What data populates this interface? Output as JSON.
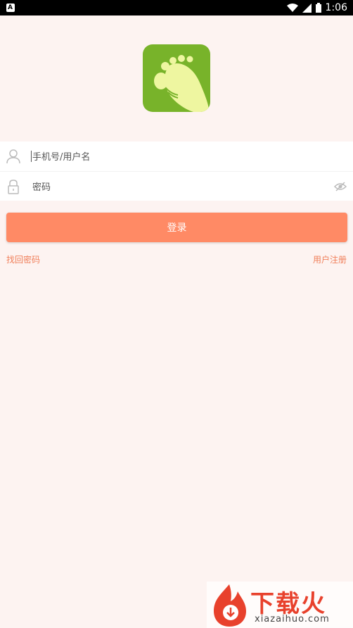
{
  "status_bar": {
    "time": "1:06",
    "notification_icon": "A"
  },
  "logo": {
    "name": "footprint-logo",
    "bg_color": "#78b32a",
    "foot_color": "#eef6a0"
  },
  "login_form": {
    "username": {
      "placeholder": "手机号/用户名",
      "value": ""
    },
    "password": {
      "placeholder": "密码",
      "value": ""
    },
    "login_label": "登录",
    "forgot_label": "找回密码",
    "register_label": "用户注册"
  },
  "colors": {
    "accent": "#ff8a65",
    "link": "#f07f5a",
    "background": "#fdf3f1"
  },
  "watermark": {
    "cn": "下载火",
    "en": "xiazaihuo.com"
  }
}
